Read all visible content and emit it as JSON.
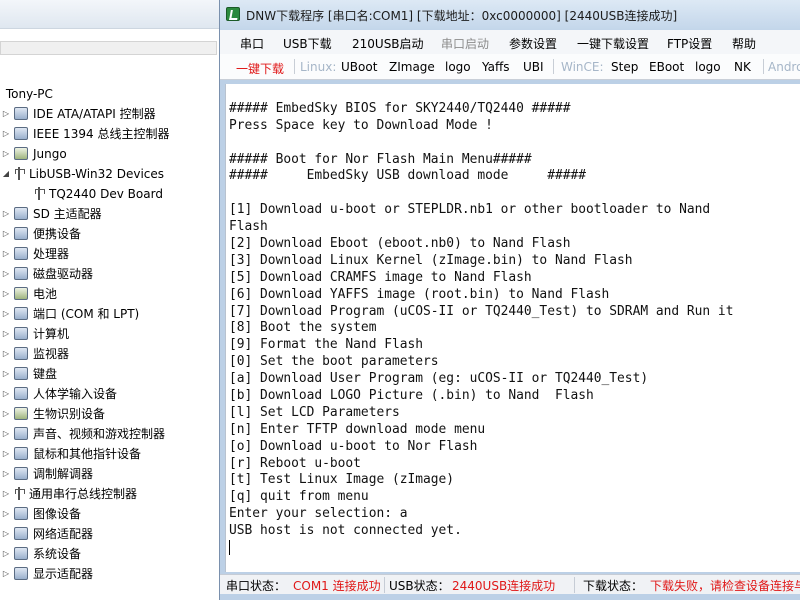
{
  "device_manager": {
    "root": "Tony-PC",
    "items": [
      {
        "label": "IDE ATA/ATAPI 控制器",
        "icon": "ide-controller-icon",
        "expanded": false
      },
      {
        "label": "IEEE 1394 总线主控制器",
        "icon": "ieee1394-icon",
        "expanded": false
      },
      {
        "label": "Jungo",
        "icon": "jungo-icon",
        "expanded": false
      },
      {
        "label": "LibUSB-Win32 Devices",
        "icon": "usb-icon",
        "expanded": true
      },
      {
        "label": "TQ2440 Dev Board",
        "icon": "usb-device-icon",
        "child": true
      },
      {
        "label": "SD 主适配器",
        "icon": "sd-host-icon",
        "expanded": false
      },
      {
        "label": "便携设备",
        "icon": "portable-device-icon",
        "expanded": false
      },
      {
        "label": "处理器",
        "icon": "processor-icon",
        "expanded": false
      },
      {
        "label": "磁盘驱动器",
        "icon": "disk-drive-icon",
        "expanded": false
      },
      {
        "label": "电池",
        "icon": "battery-icon",
        "expanded": false
      },
      {
        "label": "端口 (COM 和 LPT)",
        "icon": "port-icon",
        "expanded": false
      },
      {
        "label": "计算机",
        "icon": "computer-icon",
        "expanded": false
      },
      {
        "label": "监视器",
        "icon": "monitor-icon",
        "expanded": false
      },
      {
        "label": "键盘",
        "icon": "keyboard-icon",
        "expanded": false
      },
      {
        "label": "人体学输入设备",
        "icon": "hid-icon",
        "expanded": false
      },
      {
        "label": "生物识别设备",
        "icon": "biometric-icon",
        "expanded": false
      },
      {
        "label": "声音、视频和游戏控制器",
        "icon": "sound-icon",
        "expanded": false
      },
      {
        "label": "鼠标和其他指针设备",
        "icon": "mouse-icon",
        "expanded": false
      },
      {
        "label": "调制解调器",
        "icon": "modem-icon",
        "expanded": false
      },
      {
        "label": "通用串行总线控制器",
        "icon": "usb-controller-icon",
        "expanded": false
      },
      {
        "label": "图像设备",
        "icon": "imaging-icon",
        "expanded": false
      },
      {
        "label": "网络适配器",
        "icon": "network-adapter-icon",
        "expanded": false
      },
      {
        "label": "系统设备",
        "icon": "system-device-icon",
        "expanded": false
      },
      {
        "label": "显示适配器",
        "icon": "display-adapter-icon",
        "expanded": false
      }
    ]
  },
  "dnw": {
    "title": "DNW下载程序 [串口名:COM1] [下载地址：0xc0000000]  [2440USB连接成功]",
    "menu": [
      {
        "label": "串口",
        "disabled": false
      },
      {
        "label": "USB下载",
        "disabled": false
      },
      {
        "label": "210USB启动",
        "disabled": false
      },
      {
        "label": "串口启动",
        "disabled": true
      },
      {
        "label": "参数设置",
        "disabled": false
      },
      {
        "label": "一键下载设置",
        "disabled": false
      },
      {
        "label": "FTP设置",
        "disabled": false
      },
      {
        "label": "帮助",
        "disabled": false
      }
    ],
    "toolbar": {
      "one_key": "一键下载",
      "linux_label": "Linux:",
      "linux_items": [
        "UBoot",
        "ZImage",
        "logo",
        "Yaffs",
        "UBI"
      ],
      "wince_label": "WinCE:",
      "wince_items": [
        "Step",
        "EBoot",
        "logo",
        "NK"
      ],
      "android_label": "Andro"
    },
    "console_lines": [
      "",
      "##### EmbedSky BIOS for SKY2440/TQ2440 #####",
      "Press Space key to Download Mode !",
      "",
      "##### Boot for Nor Flash Main Menu#####",
      "#####     EmbedSky USB download mode     #####",
      "",
      "[1] Download u-boot or STEPLDR.nb1 or other bootloader to Nand",
      "Flash",
      "[2] Download Eboot (eboot.nb0) to Nand Flash",
      "[3] Download Linux Kernel (zImage.bin) to Nand Flash",
      "[5] Download CRAMFS image to Nand Flash",
      "[6] Download YAFFS image (root.bin) to Nand Flash",
      "[7] Download Program (uCOS-II or TQ2440_Test) to SDRAM and Run it",
      "[8] Boot the system",
      "[9] Format the Nand Flash",
      "[0] Set the boot parameters",
      "[a] Download User Program (eg: uCOS-II or TQ2440_Test)",
      "[b] Download LOGO Picture (.bin) to Nand  Flash",
      "[l] Set LCD Parameters",
      "[n] Enter TFTP download mode menu",
      "[o] Download u-boot to Nor Flash",
      "[r] Reboot u-boot",
      "[t] Test Linux Image (zImage)",
      "[q] quit from menu",
      "Enter your selection: a",
      "USB host is not connected yet."
    ],
    "status": {
      "serial_label": "串口状态：",
      "serial_value": "COM1 连接成功",
      "usb_label": "USB状态：",
      "usb_value": "2440USB连接成功",
      "download_label": "下载状态：",
      "download_value": "下载失败，请检查设备连接与"
    },
    "colors": {
      "red": "#e01818",
      "disabled": "#8c8c8c",
      "titlebar": "#c3d6ea"
    }
  }
}
